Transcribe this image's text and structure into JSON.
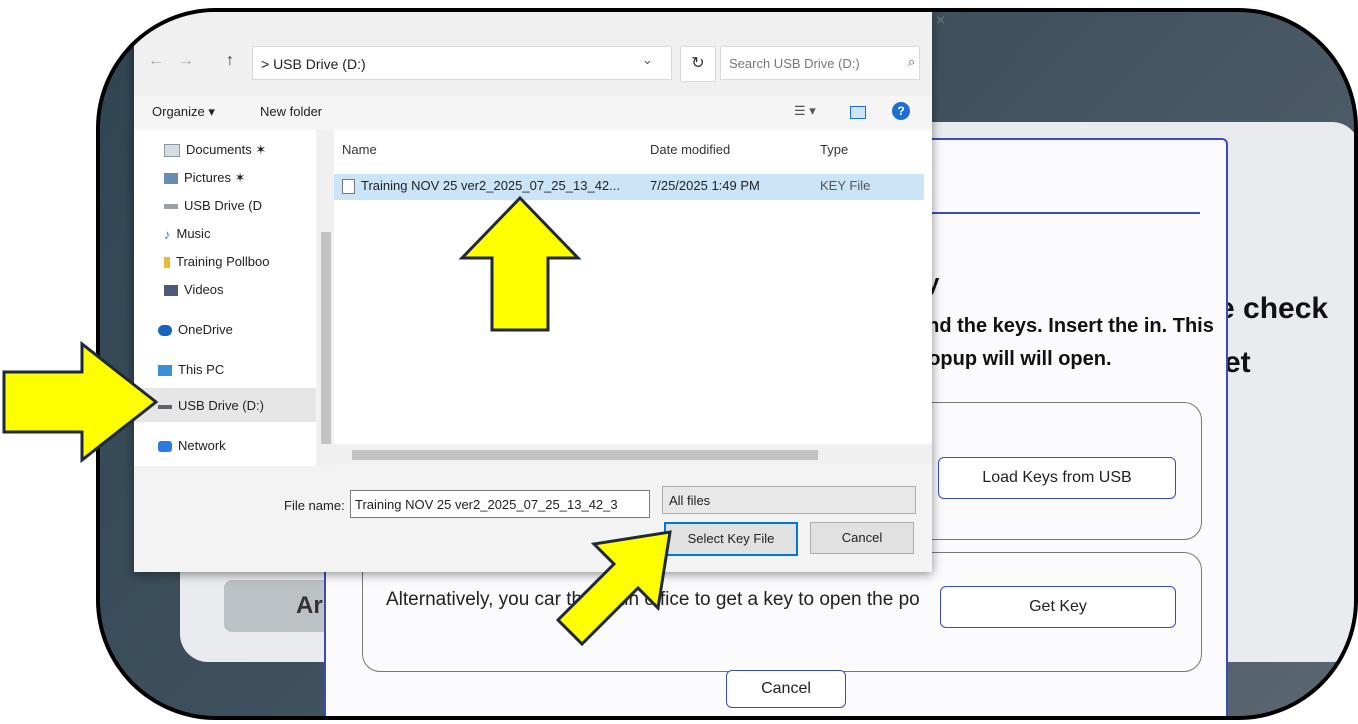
{
  "background": {
    "partial_text_1": "e check",
    "partial_text_2": "et",
    "partial_button": "Ar"
  },
  "popup": {
    "heading_fragment": "y",
    "instructions": "end the keys. Insert the in. This popup will will open.",
    "load_keys_button": "Load Keys from USB",
    "alternative_text": "Alternatively, you car        the main office to get a key to open the po",
    "get_key_button": "Get Key",
    "cancel_button": "Cancel"
  },
  "dialog": {
    "nav": {
      "back": "←",
      "forward": "→",
      "up": "↑"
    },
    "address": "> USB Drive (D:)",
    "search_placeholder": "Search USB Drive (D:)",
    "toolbar": {
      "organize": "Organize ▾",
      "new_folder": "New folder"
    },
    "sidebar": [
      {
        "label": "Documents",
        "icon": "document-icon"
      },
      {
        "label": "Pictures",
        "icon": "pictures-icon"
      },
      {
        "label": "USB Drive (D",
        "icon": "usb-drive-icon"
      },
      {
        "label": "Music",
        "icon": "music-icon"
      },
      {
        "label": "Training Pollboo",
        "icon": "folder-icon"
      },
      {
        "label": "Videos",
        "icon": "video-icon"
      },
      {
        "label": "OneDrive",
        "icon": "cloud-icon"
      },
      {
        "label": "This PC",
        "icon": "computer-icon"
      },
      {
        "label": "USB Drive (D:)",
        "icon": "usb-drive-icon",
        "selected": true
      },
      {
        "label": "Network",
        "icon": "network-icon"
      }
    ],
    "columns": {
      "name": "Name",
      "date_modified": "Date modified",
      "type": "Type"
    },
    "files": [
      {
        "name": "Training NOV 25 ver2_2025_07_25_13_42...",
        "date_modified": "7/25/2025 1:49 PM",
        "type": "KEY File",
        "selected": true
      }
    ],
    "file_name_label": "File name:",
    "file_name_value": "Training NOV 25 ver2_2025_07_25_13_42_3",
    "filter_value": "All files",
    "select_button": "Select Key File",
    "cancel_button": "Cancel"
  },
  "colors": {
    "accent": "#3b4cc0",
    "selection": "#cce4f7",
    "annotation_arrow": "#ffff00"
  }
}
